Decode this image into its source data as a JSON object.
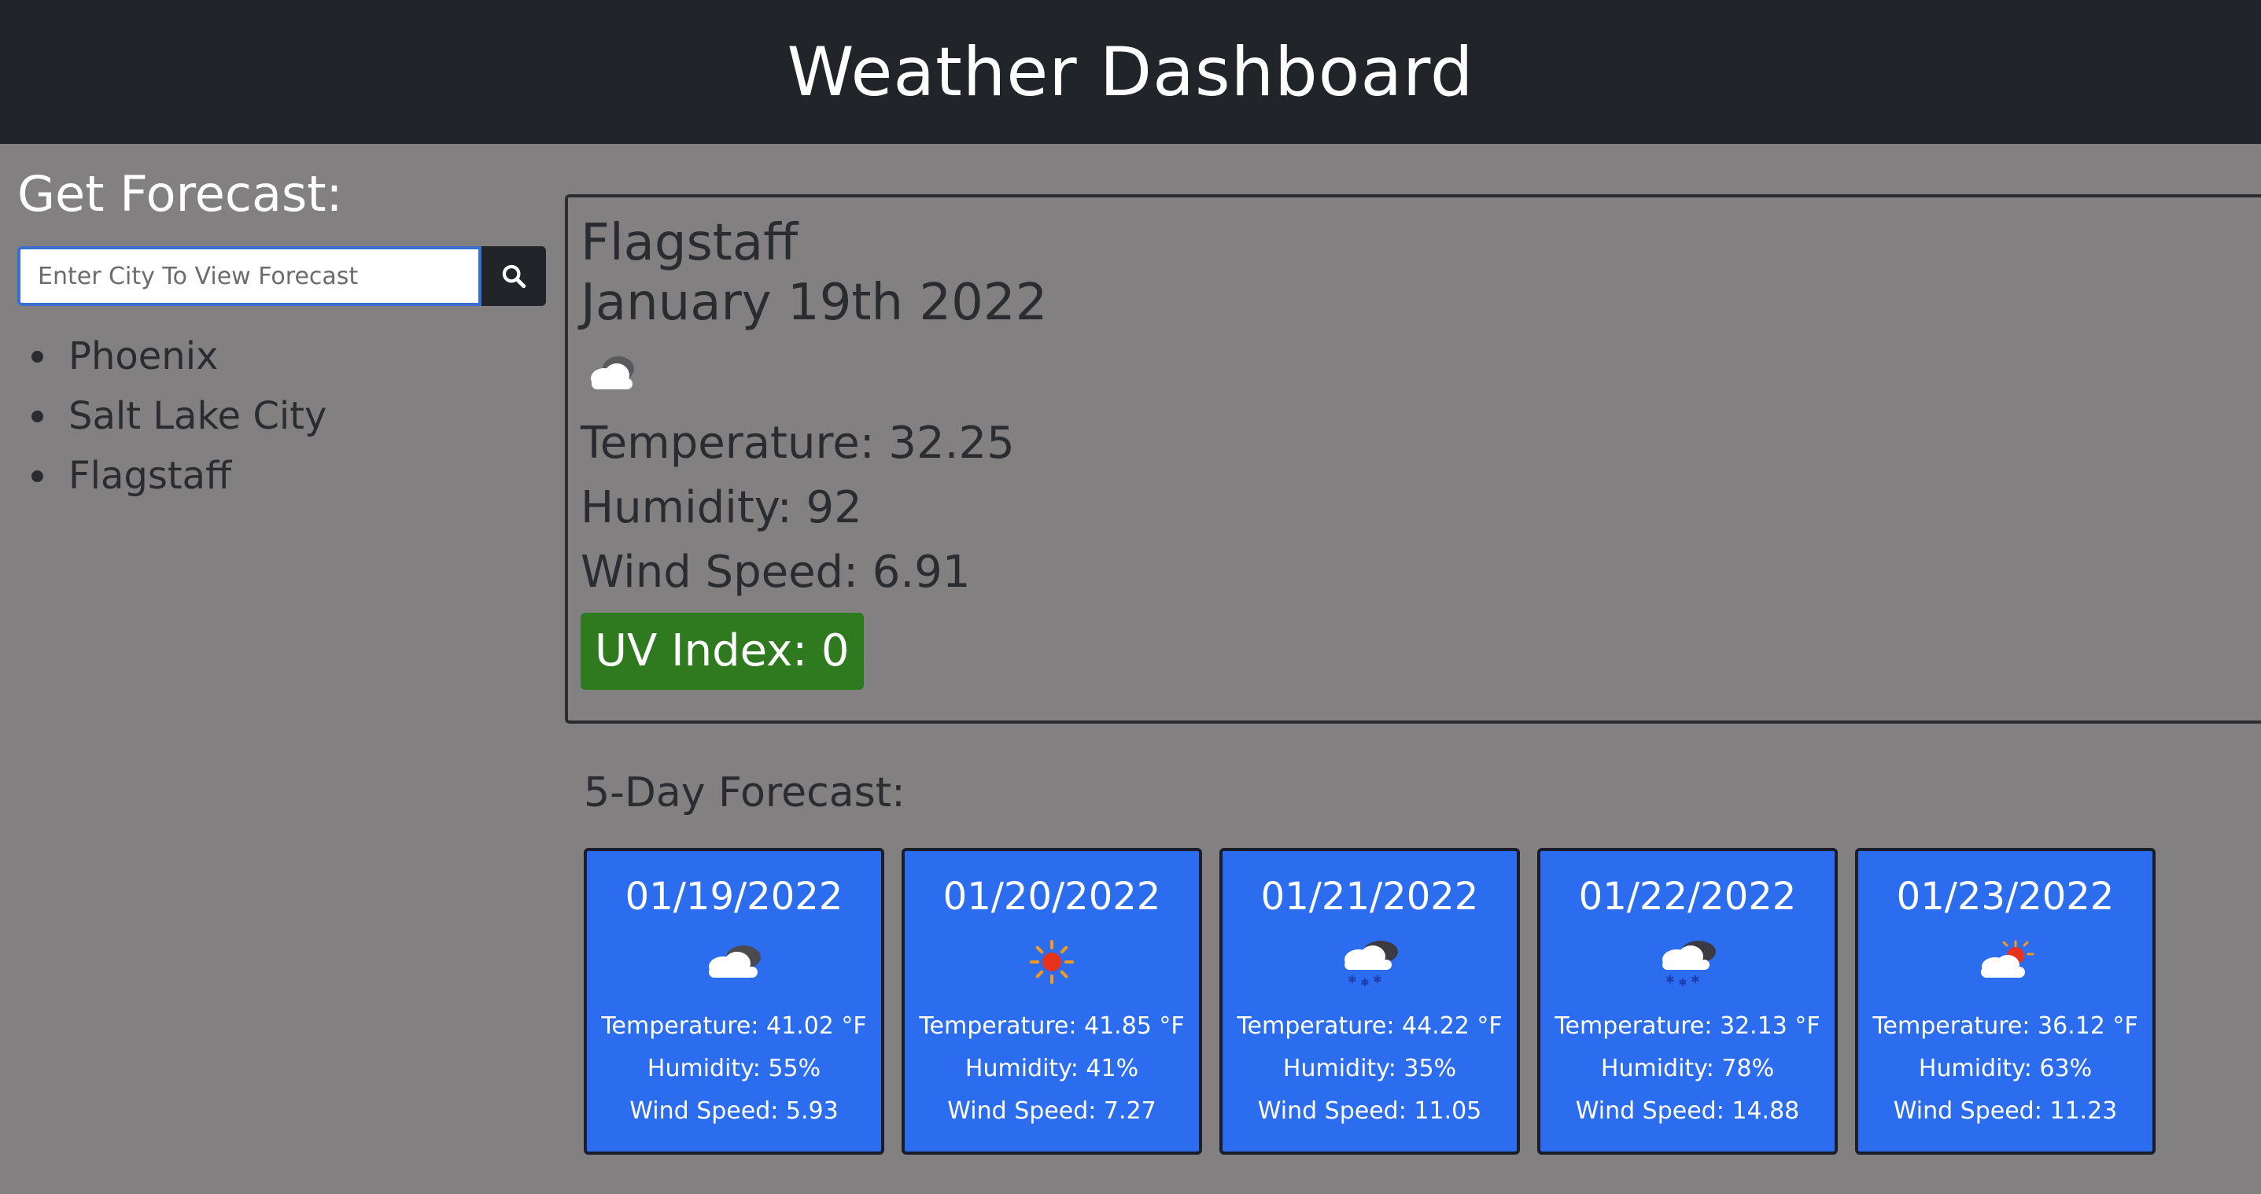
{
  "header": {
    "title": "Weather Dashboard"
  },
  "sidebar": {
    "title": "Get Forecast:",
    "search": {
      "placeholder": "Enter City To View Forecast",
      "value": ""
    },
    "history": [
      "Phoenix",
      "Salt Lake City",
      "Flagstaff"
    ]
  },
  "current": {
    "city": "Flagstaff",
    "date": "January 19th 2022",
    "icon": "cloud-icon",
    "temperature": "Temperature: 32.25",
    "humidity": "Humidity: 92",
    "wind": "Wind Speed: 6.91",
    "uv": "UV Index: 0",
    "uv_color": "#2f7a1f"
  },
  "forecast": {
    "title": "5-Day Forecast:",
    "card_color": "#2c6df0",
    "days": [
      {
        "date": "01/19/2022",
        "icon": "cloud-icon",
        "temp": "Temperature: 41.02 °F",
        "humidity": "Humidity: 55%",
        "wind": "Wind Speed: 5.93"
      },
      {
        "date": "01/20/2022",
        "icon": "sun-icon",
        "temp": "Temperature: 41.85 °F",
        "humidity": "Humidity: 41%",
        "wind": "Wind Speed: 7.27"
      },
      {
        "date": "01/21/2022",
        "icon": "snow-cloud-icon",
        "temp": "Temperature: 44.22 °F",
        "humidity": "Humidity: 35%",
        "wind": "Wind Speed: 11.05"
      },
      {
        "date": "01/22/2022",
        "icon": "snow-cloud-icon",
        "temp": "Temperature: 32.13 °F",
        "humidity": "Humidity: 78%",
        "wind": "Wind Speed: 14.88"
      },
      {
        "date": "01/23/2022",
        "icon": "partly-cloudy-icon",
        "temp": "Temperature: 36.12 °F",
        "humidity": "Humidity: 63%",
        "wind": "Wind Speed: 11.23"
      }
    ]
  }
}
